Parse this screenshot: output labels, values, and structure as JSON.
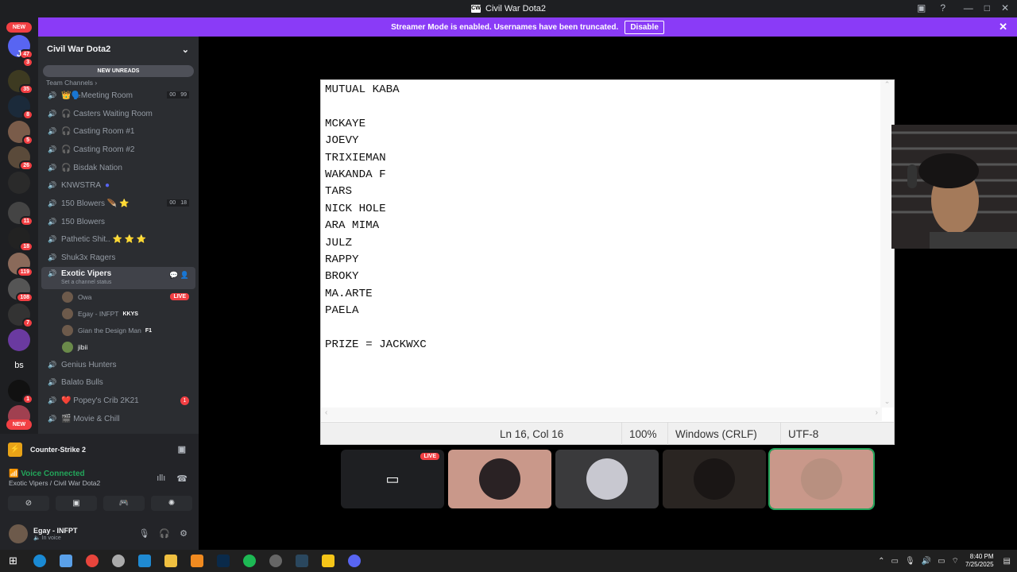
{
  "window": {
    "title": "Civil War Dota2",
    "logo_text": "CW"
  },
  "banner": {
    "text": "Streamer Mode is enabled. Usernames have been truncated.",
    "button": "Disable"
  },
  "servers": [
    {
      "label": "",
      "badge": "47"
    },
    {
      "label": "J",
      "badge": "3"
    },
    {
      "label": "",
      "badge": "35"
    },
    {
      "label": "",
      "badge": "8"
    },
    {
      "label": "",
      "badge": "5"
    },
    {
      "label": "",
      "badge": "26"
    },
    {
      "label": "",
      "badge": ""
    },
    {
      "label": "",
      "badge": "11"
    },
    {
      "label": "",
      "badge": "18"
    },
    {
      "label": "",
      "badge": "119"
    },
    {
      "label": "",
      "badge": "108"
    },
    {
      "label": "",
      "badge": "7"
    },
    {
      "label": "",
      "badge": ""
    },
    {
      "label": "bs",
      "badge": ""
    },
    {
      "label": "",
      "badge": "1"
    },
    {
      "label": "",
      "badge": ""
    }
  ],
  "new_label": "NEW",
  "sidebar": {
    "server_name": "Civil War Dota2",
    "new_unreads": "NEW UNREADS",
    "category": "Team Channels",
    "channels": [
      {
        "name": "👑🗣️Meeting Room",
        "c1": "00",
        "c2": "99"
      },
      {
        "name": "🎧 Casters Waiting Room"
      },
      {
        "name": "🎧 Casting Room #1"
      },
      {
        "name": "🎧 Casting Room #2"
      },
      {
        "name": "🎧 Bisdak Nation"
      },
      {
        "name": "KNWSTRA"
      },
      {
        "name": "150 Blowers 🪶 ⭐",
        "c1": "00",
        "c2": "18"
      },
      {
        "name": "150 Blowers"
      },
      {
        "name": "Pathetic Shit.. ⭐ ⭐ ⭐"
      },
      {
        "name": "Shuk3x Ragers"
      }
    ],
    "active_channel": {
      "name": "Exotic Vipers",
      "sub": "Set a channel status"
    },
    "members": [
      {
        "name": "Owa",
        "live": "LIVE"
      },
      {
        "name": "Egay - INFPT",
        "tag": "KKYS"
      },
      {
        "name": "Gian the Design Man",
        "tag": "F1"
      },
      {
        "name": "jibii"
      }
    ],
    "after": [
      {
        "name": "Genius Hunters"
      },
      {
        "name": "Balato Bulls"
      },
      {
        "name": "❤️ Popey's Crib 2K21",
        "badge": "1"
      },
      {
        "name": "🎬 Movie & Chill"
      }
    ]
  },
  "activity": {
    "game": "Counter-Strike 2"
  },
  "voice": {
    "status": "Voice Connected",
    "location": "Exotic Vipers / Civil War Dota2"
  },
  "user": {
    "name": "Egay - INFPT",
    "status": "In voice"
  },
  "notepad": {
    "lines": [
      "MUTUAL KABA",
      "",
      "MCKAYE",
      "JOEVY",
      "TRIXIEMAN",
      "WAKANDA F",
      "TARS",
      "NICK HOLE",
      "ARA MIMA",
      "JULZ",
      "RAPPY",
      "BROKY",
      "MA.ARTE",
      "PAELA",
      "",
      "PRIZE = JACKWXC"
    ],
    "position": "Ln 16, Col 16",
    "zoom": "100%",
    "line_ending": "Windows (CRLF)",
    "encoding": "UTF-8"
  },
  "tiles": {
    "live_label": "LIVE"
  },
  "clock": {
    "time": "8:40 PM",
    "date": "7/25/2025"
  },
  "colors": {
    "accent": "#8a3bf7",
    "live": "#f23f43",
    "connected": "#23a55a"
  }
}
